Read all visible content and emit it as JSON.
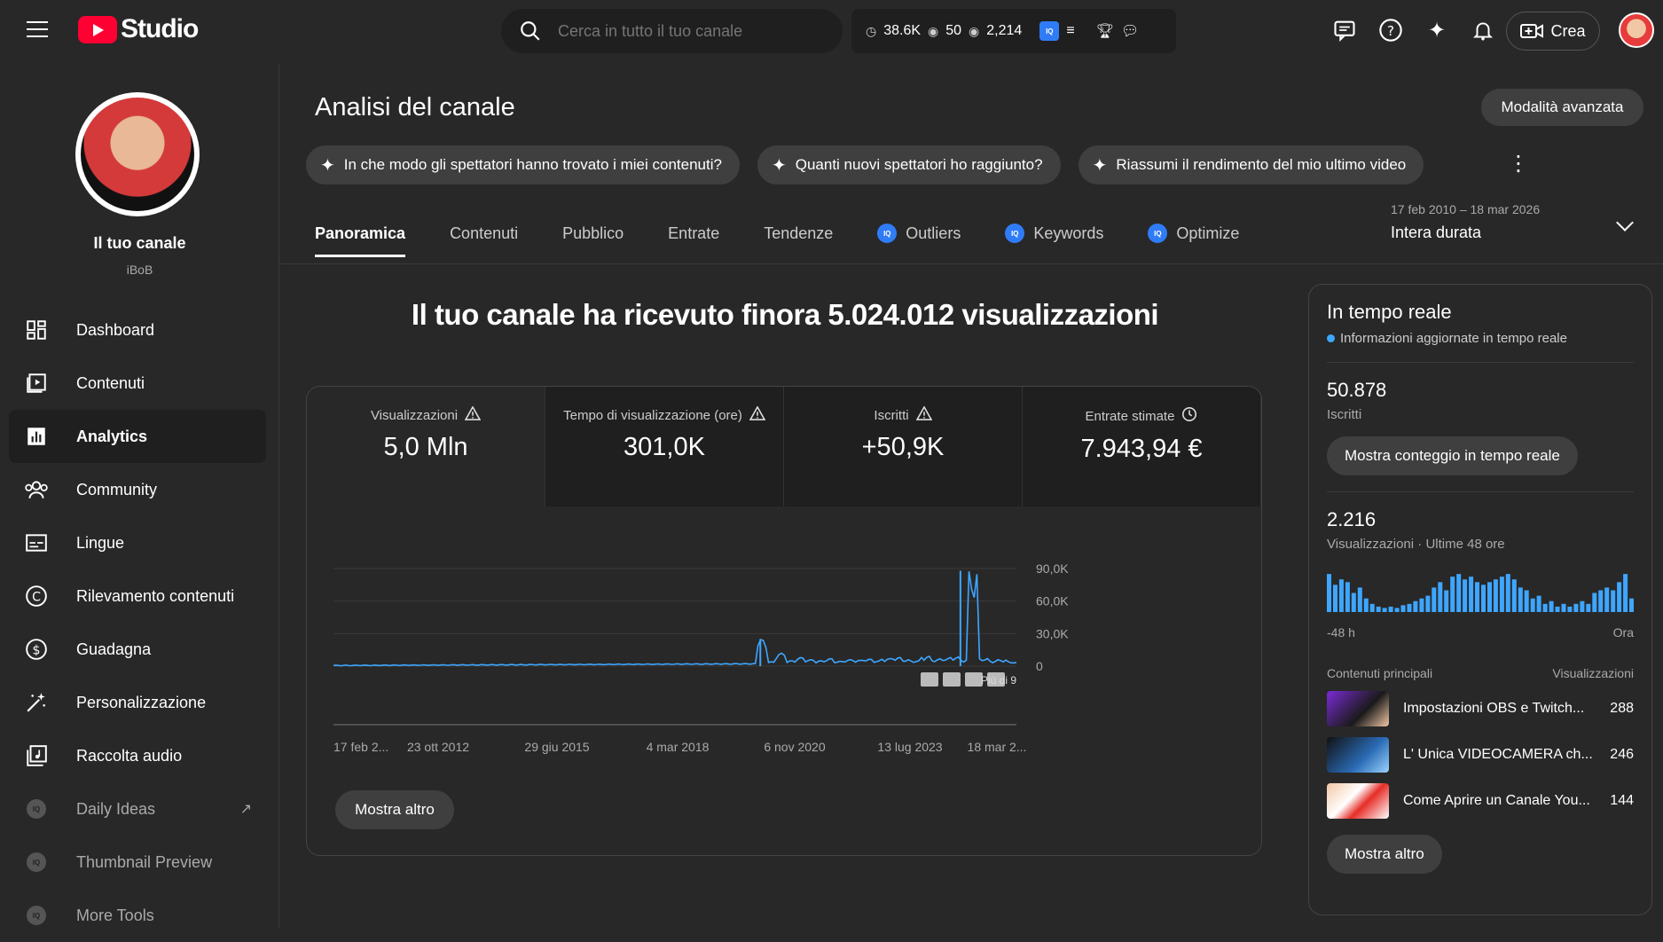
{
  "header": {
    "logo_text": "Studio",
    "search_placeholder": "Cerca in tutto il tuo canale",
    "stats": {
      "watch": "38.6K",
      "views_count": "50",
      "views2": "2,214"
    },
    "create_label": "Crea"
  },
  "channel": {
    "name": "Il tuo canale",
    "handle": "iBoB"
  },
  "nav": [
    {
      "label": "Dashboard",
      "icon": "dashboard-icon"
    },
    {
      "label": "Contenuti",
      "icon": "content-icon"
    },
    {
      "label": "Analytics",
      "icon": "analytics-icon",
      "active": true
    },
    {
      "label": "Community",
      "icon": "community-icon"
    },
    {
      "label": "Lingue",
      "icon": "subtitles-icon"
    },
    {
      "label": "Rilevamento contenuti",
      "icon": "copyright-icon"
    },
    {
      "label": "Guadagna",
      "icon": "dollar-icon"
    },
    {
      "label": "Personalizzazione",
      "icon": "magic-wand-icon"
    },
    {
      "label": "Raccolta audio",
      "icon": "audio-library-icon"
    },
    {
      "label": "Daily Ideas",
      "icon": "vidiq-icon",
      "dim": true
    },
    {
      "label": "Thumbnail Preview",
      "icon": "vidiq-icon",
      "dim": true
    },
    {
      "label": "More Tools",
      "icon": "vidiq-icon",
      "dim": true
    }
  ],
  "page": {
    "title": "Analisi del canale",
    "advanced_label": "Modalità avanzata",
    "chips": [
      "In che modo gli spettatori hanno trovato i miei contenuti?",
      "Quanti nuovi spettatori ho raggiunto?",
      "Riassumi il rendimento del mio ultimo video"
    ],
    "tabs": [
      "Panoramica",
      "Contenuti",
      "Pubblico",
      "Entrate",
      "Tendenze",
      "Outliers",
      "Keywords",
      "Optimize"
    ],
    "date_range": "17 feb 2010 – 18 mar 2026",
    "date_value": "Intera durata",
    "headline": "Il tuo canale ha ricevuto finora 5.024.012 visualizzazioni",
    "show_more": "Mostra altro"
  },
  "metrics": [
    {
      "label": "Visualizzazioni",
      "value": "5,0 Mln",
      "icon": "warning-icon"
    },
    {
      "label": "Tempo di visualizzazione (ore)",
      "value": "301,0K",
      "icon": "warning-icon"
    },
    {
      "label": "Iscritti",
      "value": "+50,9K",
      "icon": "warning-icon"
    },
    {
      "label": "Entrate stimate",
      "value": "7.943,94 €",
      "icon": "clock-icon"
    }
  ],
  "chart_data": {
    "type": "line",
    "y_ticks": [
      "90,0K",
      "60,0K",
      "30,0K",
      "0"
    ],
    "ylim": [
      0,
      90000
    ],
    "x_ticks": [
      "17 feb 2...",
      "23 ott 2012",
      "29 giu 2015",
      "4 mar 2018",
      "6 nov 2020",
      "13 lug 2023",
      "18 mar 2..."
    ],
    "note": "Più di 9",
    "series": [
      {
        "values": [
          400,
          500,
          600,
          700,
          800,
          1000,
          1200,
          1500,
          1400,
          1300,
          1600,
          1800,
          1700,
          2000,
          1900,
          2200,
          2100,
          2500,
          2300,
          25000,
          4000,
          12000,
          5000,
          8000,
          6000,
          5000,
          7000,
          4500,
          6000,
          5500,
          6500,
          5000,
          7000,
          8000,
          6000,
          5000,
          9000,
          6000,
          7000,
          8500,
          6000,
          88000,
          7000,
          5000,
          6000,
          4000,
          3500
        ]
      }
    ]
  },
  "realtime": {
    "title": "In tempo reale",
    "subtitle": "Informazioni aggiornate in tempo reale",
    "subs_value": "50.878",
    "subs_label": "Iscritti",
    "live_btn": "Mostra conteggio in tempo reale",
    "views_value": "2.216",
    "views_label": "Visualizzazioni · Ultime 48 ore",
    "bars": [
      28,
      20,
      24,
      22,
      14,
      18,
      10,
      6,
      4,
      3,
      4,
      3,
      5,
      6,
      8,
      10,
      12,
      18,
      22,
      16,
      26,
      28,
      24,
      26,
      22,
      20,
      22,
      24,
      26,
      28,
      24,
      18,
      16,
      10,
      12,
      6,
      8,
      4,
      6,
      4,
      6,
      8,
      6,
      14,
      16,
      18,
      16,
      22,
      28,
      10
    ],
    "axis_left": "-48 h",
    "axis_right": "Ora",
    "col_left": "Contenuti principali",
    "col_right": "Visualizzazioni",
    "top": [
      {
        "title": "Impostazioni OBS e Twitch...",
        "views": "288"
      },
      {
        "title": "L' Unica VIDEOCAMERA ch...",
        "views": "246"
      },
      {
        "title": "Come Aprire un Canale You...",
        "views": "144"
      }
    ],
    "show_more": "Mostra altro"
  }
}
